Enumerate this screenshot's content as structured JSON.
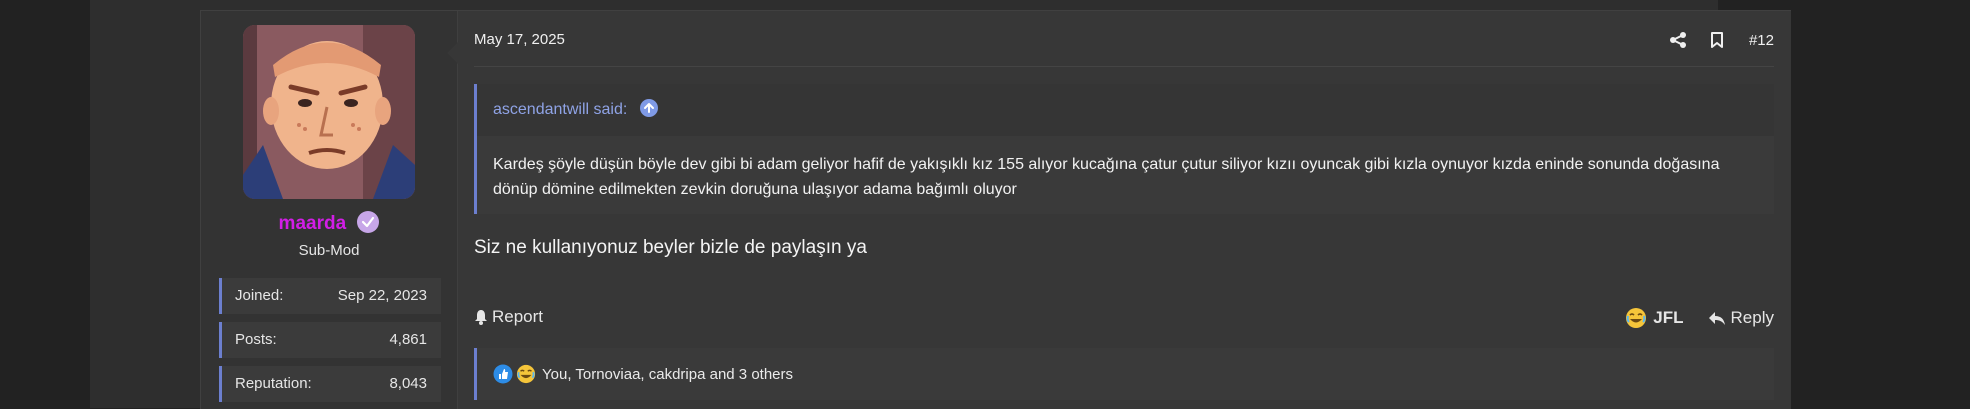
{
  "post": {
    "date": "May 17, 2025",
    "number": "#12",
    "user": {
      "username": "maarda",
      "title": "Sub-Mod",
      "stats": [
        {
          "label": "Joined:",
          "value": "Sep 22, 2023"
        },
        {
          "label": "Posts:",
          "value": "4,861"
        },
        {
          "label": "Reputation:",
          "value": "8,043"
        }
      ]
    },
    "quote": {
      "author": "ascendantwill said:",
      "text": "Kardeş şöyle düşün böyle dev gibi bi adam geliyor hafif de yakışıklı kız 155 alıyor kucağına çatur çutur siliyor kızıı oyuncak gibi kızla oynuyor kızda eninde sonunda doğasına dönüp dömine edilmekten zevkin doruğuna ulaşıyor adama bağımlı oluyor"
    },
    "message": "Siz ne kullanıyonuz beyler bizle de paylaşın ya",
    "actions": {
      "report": "Report",
      "reaction_label": "JFL",
      "reply": "Reply"
    },
    "reactions_summary": "You, Tornoviaa, cakdripa and 3 others"
  },
  "colors": {
    "username": "#d21ee6",
    "accent": "#6c7fcf",
    "quote_author": "#8fa3e6"
  },
  "icons": [
    "share-icon",
    "bookmark-icon",
    "verified-badge-icon",
    "arrow-up-icon",
    "bell-icon",
    "laughing-emoji-icon",
    "reply-arrow-icon",
    "like-emoji-icon"
  ]
}
